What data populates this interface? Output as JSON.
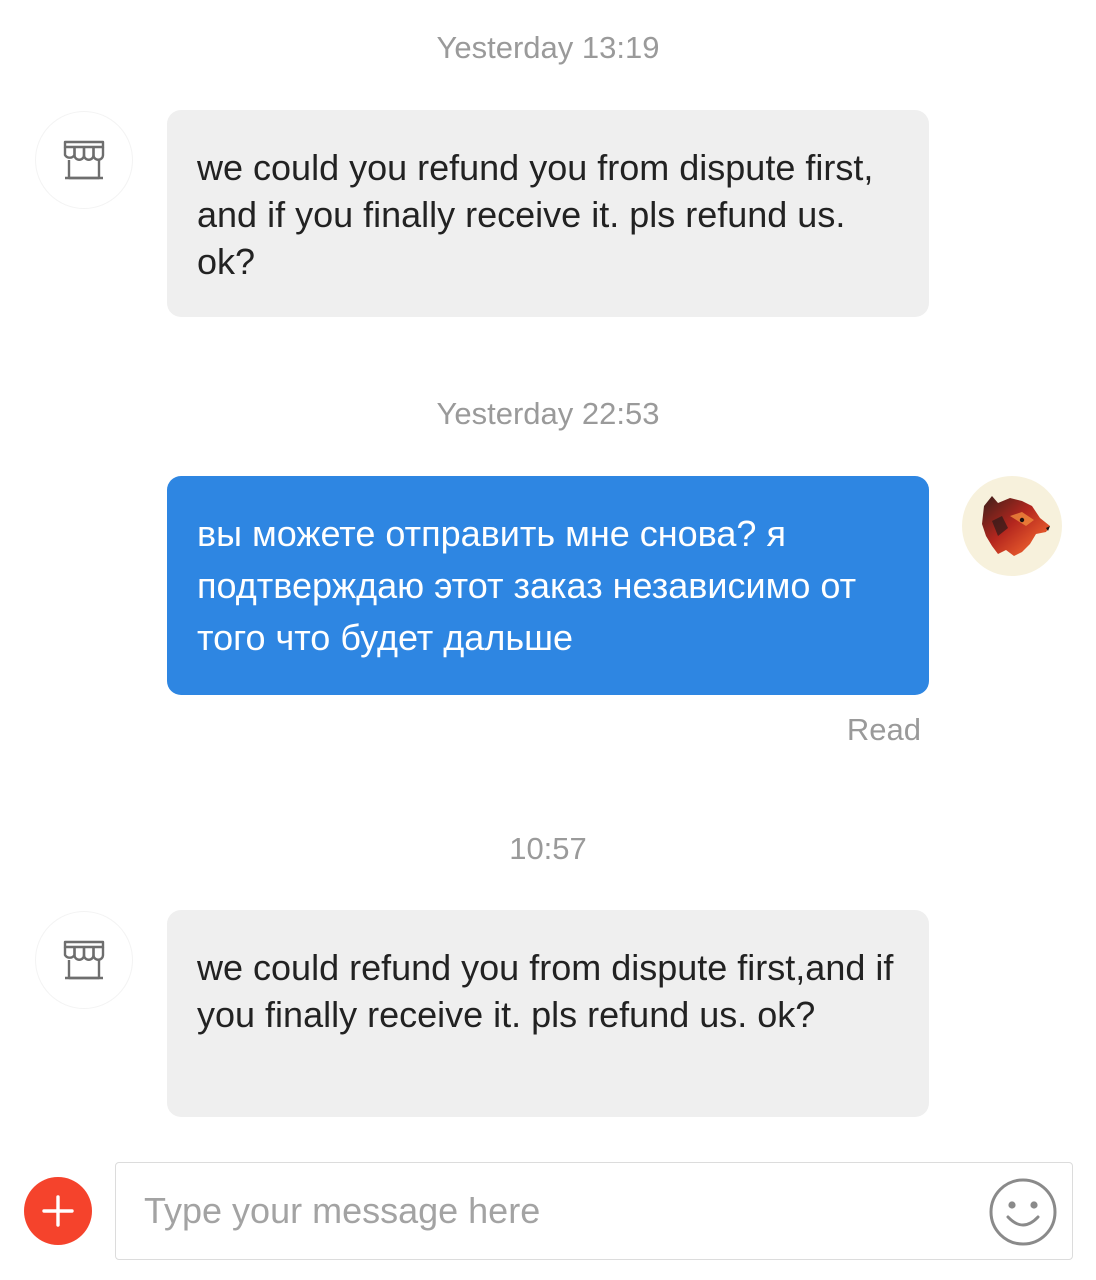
{
  "messages": [
    {
      "timestamp": "Yesterday 13:19",
      "direction": "incoming",
      "sender_avatar": "shop-icon",
      "text": "we could you refund you from dispute first, and if you finally receive it. pls refund us. ok?"
    },
    {
      "timestamp": "Yesterday 22:53",
      "direction": "outgoing",
      "sender_avatar": "user-avatar",
      "text": "вы можете отправить мне снова? я подтверждаю этот заказ независимо от того что будет дальше",
      "status": "Read"
    },
    {
      "timestamp": "10:57",
      "direction": "incoming",
      "sender_avatar": "shop-icon",
      "text": "we could refund you from dispute first,and if you finally receive it. pls refund us. ok?"
    }
  ],
  "composer": {
    "placeholder": "Type your message here",
    "value": "",
    "add_icon": "plus-icon",
    "emoji_icon": "smiley-icon"
  },
  "colors": {
    "incoming_bubble": "#efefef",
    "outgoing_bubble": "#2e86e2",
    "add_button": "#f5432c",
    "timestamp_text": "#9a9a9a"
  }
}
